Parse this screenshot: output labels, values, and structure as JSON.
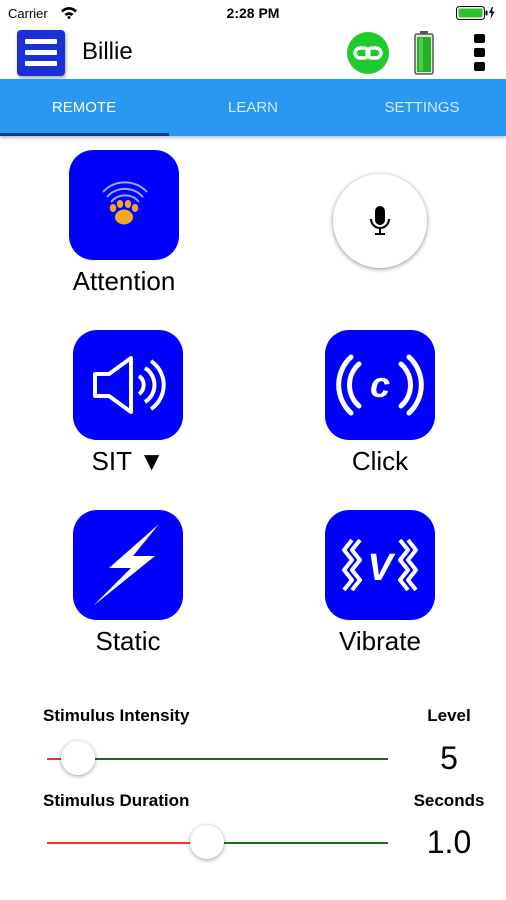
{
  "status_bar": {
    "carrier": "Carrier",
    "time": "2:28 PM"
  },
  "header": {
    "title": "Billie",
    "link_color": "#1fc92e",
    "battery_color": "#22b222"
  },
  "tabs": [
    {
      "label": "REMOTE",
      "active": true
    },
    {
      "label": "LEARN",
      "active": false
    },
    {
      "label": "SETTINGS",
      "active": false
    }
  ],
  "commands": {
    "attention": {
      "label": "Attention",
      "icon": "paw-signal-icon"
    },
    "sit": {
      "label": "SIT ▼",
      "icon": "speaker-icon"
    },
    "click": {
      "label": "Click",
      "icon": "click-icon"
    },
    "static": {
      "label": "Static",
      "icon": "lightning-icon"
    },
    "vibrate": {
      "label": "Vibrate",
      "icon": "vibrate-icon"
    }
  },
  "mic": {
    "icon": "microphone-icon"
  },
  "sliders": {
    "intensity": {
      "title": "Stimulus Intensity",
      "unit_label": "Level",
      "value": "5",
      "fraction": 0.09
    },
    "duration": {
      "title": "Stimulus Duration",
      "unit_label": "Seconds",
      "value": "1.0",
      "fraction": 0.47
    }
  },
  "colors": {
    "accent": "#2a98f2",
    "tile": "#0000ff",
    "slider_min": "#e8332e",
    "slider_max": "#1b6b1b"
  }
}
